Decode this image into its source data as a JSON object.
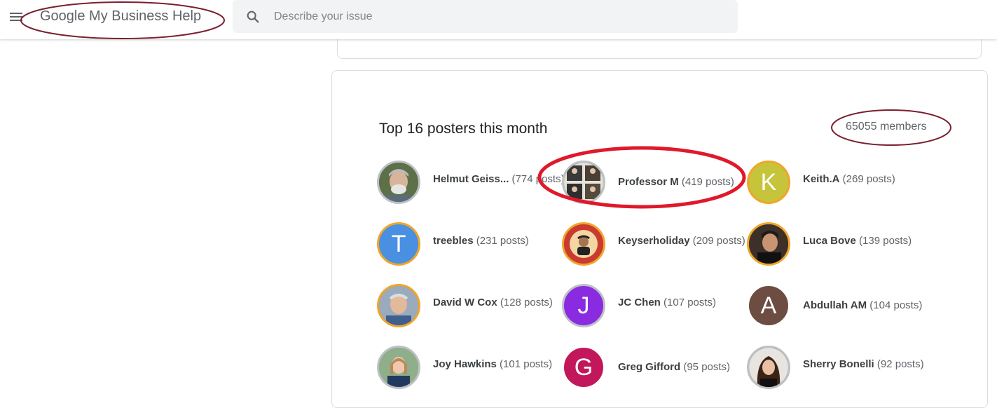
{
  "header": {
    "title": "Google My Business Help",
    "search_placeholder": "Describe your issue"
  },
  "posters_section": {
    "title": "Top 16 posters this month",
    "members": "65055 members",
    "posters": [
      {
        "name": "Helmut Geiss...",
        "count": "(774 posts)",
        "initial": "",
        "color": "#6d7f59"
      },
      {
        "name": "Professor M",
        "count": "(419 posts)",
        "initial": "",
        "color": "#4a4a4a"
      },
      {
        "name": "Keith.A",
        "count": "(269 posts)",
        "initial": "K",
        "color": "#c6c43a"
      },
      {
        "name": "treebles",
        "count": "(231 posts)",
        "initial": "T",
        "color": "#4a90e2"
      },
      {
        "name": "Keyserholiday",
        "count": "(209 posts)",
        "initial": "",
        "color": "#d9473b"
      },
      {
        "name": "Luca Bove",
        "count": "(139 posts)",
        "initial": "",
        "color": "#6b5544"
      },
      {
        "name": "David W Cox",
        "count": "(128 posts)",
        "initial": "",
        "color": "#8a9ab0"
      },
      {
        "name": "JC Chen",
        "count": "(107 posts)",
        "initial": "J",
        "color": "#8a2be2"
      },
      {
        "name": "Abdullah AM",
        "count": "(104 posts)",
        "initial": "A",
        "color": "#6d4c41"
      },
      {
        "name": "Joy Hawkins",
        "count": "(101 posts)",
        "initial": "",
        "color": "#7f9f86"
      },
      {
        "name": "Greg Gifford",
        "count": "(95 posts)",
        "initial": "G",
        "color": "#c2185b"
      },
      {
        "name": "Sherry Bonelli",
        "count": "(92 posts)",
        "initial": "",
        "color": "#2b2222"
      }
    ]
  },
  "annotation_color": "#7a1f2e",
  "highlight_color": "#e0192a"
}
